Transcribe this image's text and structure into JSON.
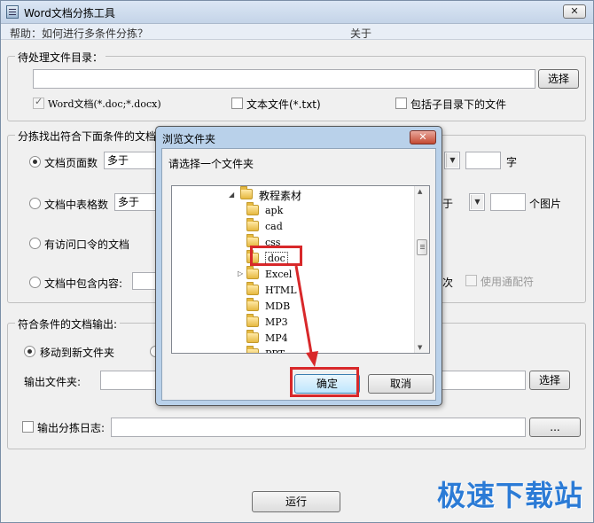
{
  "window": {
    "title": "Word文档分拣工具",
    "close_glyph": "✕"
  },
  "menu": {
    "help": "帮助：如何进行多条件分拣？",
    "about": "关于"
  },
  "source_group": {
    "legend": "待处理文件目录：",
    "path_value": "",
    "select_button": "选择",
    "word_checkbox_label": "Word文档(*.doc;*.docx)",
    "word_checked": true,
    "text_checkbox_label": "文本文件(*.txt)",
    "text_checked": false,
    "subdir_checkbox_label": "包括子目录下的文件",
    "subdir_checked": false
  },
  "criteria_group": {
    "legend": "分拣找出符合下面条件的文档",
    "page_count_label": "文档页面数",
    "page_count_compare": "多于",
    "page_count_unit": "字",
    "table_count_label": "文档中表格数",
    "table_count_compare": "多于",
    "image_compare_tail": "于",
    "image_unit": "个图片",
    "password_label": "有访问口令的文档",
    "contains_label": "文档中包含内容:",
    "times_tail": "次",
    "wildcard_label": "使用通配符"
  },
  "output_group": {
    "legend": "符合条件的文档输出:",
    "move_label": "移动到新文件夹",
    "output_folder_label": "输出文件夹:",
    "output_folder_value": "",
    "select_button": "选择",
    "log_label": "输出分拣日志:",
    "log_value": "",
    "browse_button": "..."
  },
  "run_button": "运行",
  "dialog": {
    "title": "浏览文件夹",
    "close_glyph": "✕",
    "prompt": "请选择一个文件夹",
    "parent_folder": "教程素材",
    "folders": [
      "apk",
      "cad",
      "css",
      "doc",
      "Excel",
      "HTML",
      "MDB",
      "MP3",
      "MP4",
      "PPT"
    ],
    "selected_folder": "doc",
    "ok_button": "确定",
    "cancel_button": "取消"
  },
  "watermark": "极速下载站",
  "colors": {
    "highlight": "#d8282a",
    "watermark": "#2b7bd6"
  }
}
